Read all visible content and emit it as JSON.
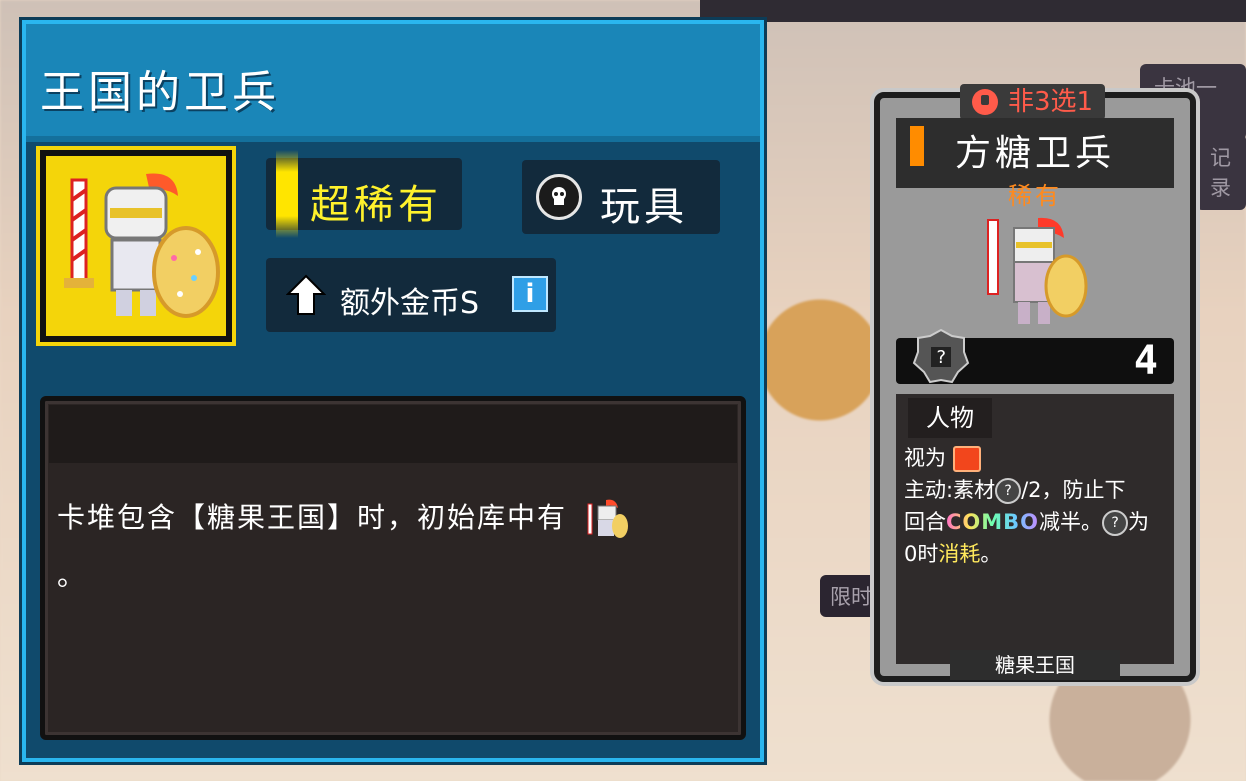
{
  "background": {
    "tab_top": "卡池一览",
    "tab_mid": "记录",
    "limit_label": "限时"
  },
  "panel": {
    "title": "王国的卫兵",
    "rarity": "超稀有",
    "type": "玩具",
    "perk": "额外金币S",
    "perk_info": "i",
    "description_part1": "卡堆包含【糖果王国】时，初始库中有",
    "description_part2": "。"
  },
  "card": {
    "badge": "非3选1",
    "name": "方糖卫兵",
    "rarity": "稀有",
    "cost_icon": "?",
    "cost_value": "4",
    "category": "人物",
    "text_view": "视为",
    "text_active_a": "主动:素材",
    "text_active_b": "/2，防止下",
    "text_active_c": "回合",
    "combo": "COMBO",
    "text_active_d": "减半。",
    "text_active_e": "为",
    "text_active_f": "0时",
    "consume": "消耗",
    "text_active_g": "。",
    "footer": "糖果王国"
  },
  "colors": {
    "panel_border": "#2ab6ef",
    "panel_bg": "#104a6c",
    "rarity_yellow": "#fff22c",
    "card_rarity_orange": "#ff8a1e",
    "badge_red": "#ff5b4a"
  },
  "icons": {
    "portrait": "knight-icon",
    "type": "skull-icon",
    "perk": "up-arrow-icon",
    "cost": "question-gear-icon"
  }
}
